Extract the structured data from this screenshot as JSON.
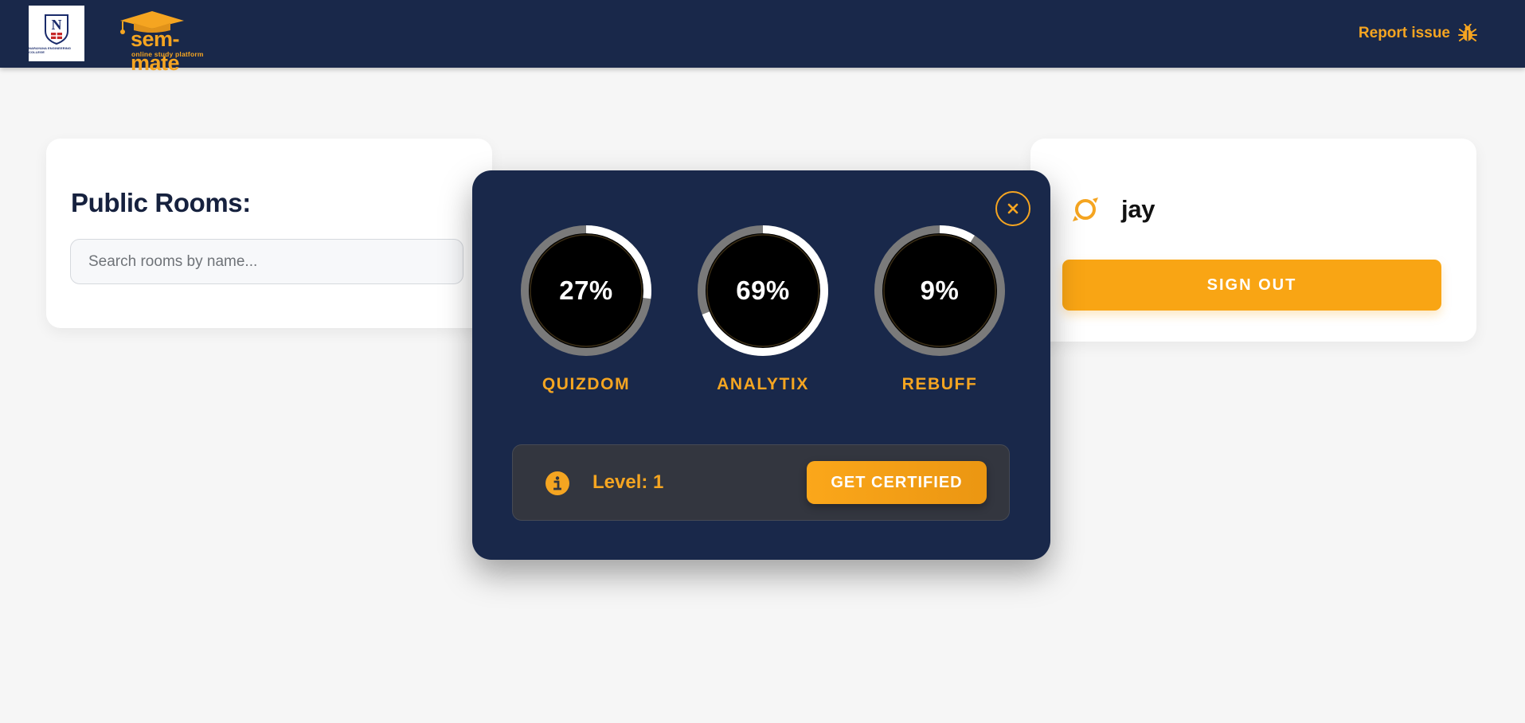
{
  "header": {
    "college_logo_text": "NARAYANA ENGINEERING COLLEGE",
    "brand_name": "sem-mate",
    "brand_tagline": "online study platform",
    "report_label": "Report issue"
  },
  "public_rooms": {
    "title": "Public Rooms:",
    "search_placeholder": "Search rooms by name..."
  },
  "profile": {
    "username": "jay",
    "signout_label": "SIGN OUT"
  },
  "modal": {
    "gauges": [
      {
        "label": "QUIZDOM",
        "percent": 27,
        "percent_text": "27%"
      },
      {
        "label": "ANALYTIX",
        "percent": 69,
        "percent_text": "69%"
      },
      {
        "label": "REBUFF",
        "percent": 9,
        "percent_text": "9%"
      }
    ],
    "level_text": "Level: 1",
    "certify_label": "GET CERTIFIED"
  },
  "colors": {
    "header_bg": "#19284a",
    "accent": "#f5a521",
    "modal_bg": "#19284a",
    "page_bg": "#f6f6f6"
  },
  "icons": {
    "report": "bug-icon",
    "user": "avatar-orbit-icon",
    "close": "close-icon",
    "info": "info-icon"
  }
}
